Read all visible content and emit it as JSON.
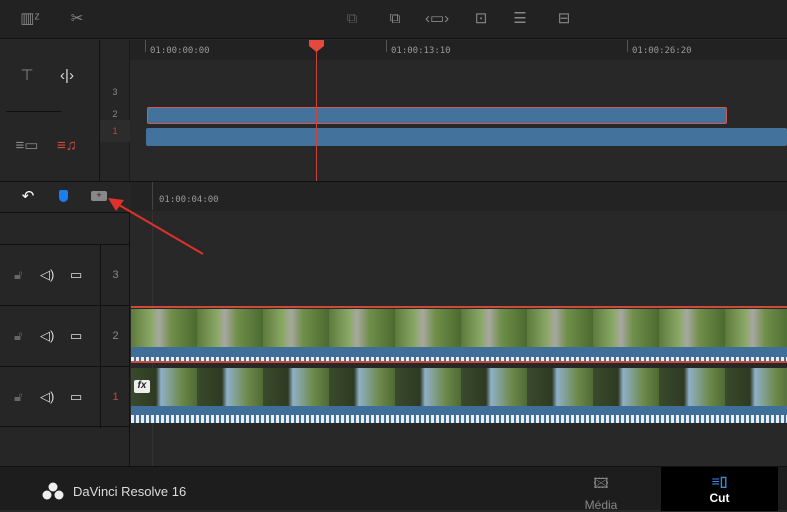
{
  "toolbar": {
    "icons": [
      "snooze-icon",
      "scissors-icon",
      "smart-insert-icon",
      "append-icon",
      "ripple-overwrite-icon",
      "close-up-icon",
      "place-on-top-icon",
      "source-overwrite-icon"
    ]
  },
  "upper_timeline": {
    "timecodes": [
      "01:00:00:00",
      "01:00:13:10",
      "01:00:26:20"
    ],
    "track_numbers": [
      "3",
      "2",
      "1"
    ]
  },
  "lower_timeline": {
    "timecode": "01:00:04:00",
    "tracks": [
      {
        "number": "3"
      },
      {
        "number": "2"
      },
      {
        "number": "1"
      }
    ],
    "fx_badge": "fx"
  },
  "footer": {
    "app_name": "DaVinci Resolve 16",
    "tabs": [
      {
        "label": "Média",
        "active": false
      },
      {
        "label": "Cut",
        "active": true
      }
    ]
  },
  "colors": {
    "playhead": "#e5483c",
    "clip": "#43739c",
    "active_track": "#c9453c"
  }
}
